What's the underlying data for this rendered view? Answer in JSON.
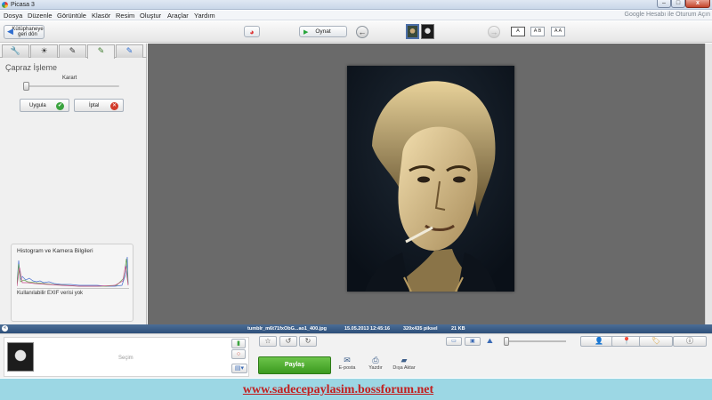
{
  "window": {
    "title": "Picasa 3",
    "controls": {
      "minimize": "–",
      "maximize": "□",
      "close": "x"
    }
  },
  "menu": {
    "items": [
      "Dosya",
      "Düzenle",
      "Görüntüle",
      "Klasör",
      "Resim",
      "Oluştur",
      "Araçlar",
      "Yardım"
    ],
    "signin": "Google Hesabı ile Oturum Açın"
  },
  "toolbar": {
    "back_to_library": "Kütüphaneye geri dön",
    "play_label": "Oynat",
    "caption_buttons": [
      "A",
      "A B",
      "A A"
    ]
  },
  "edit_panel": {
    "tabs": [
      {
        "icon": "wrench-icon",
        "glyph": "🔧"
      },
      {
        "icon": "sun-icon",
        "glyph": "☀"
      },
      {
        "icon": "brush-icon",
        "glyph": "✎"
      },
      {
        "icon": "brush-effects-icon",
        "glyph": "✎"
      },
      {
        "icon": "brush-more-icon",
        "glyph": "✎"
      }
    ],
    "active_tab": 3,
    "title": "Çapraz İşleme",
    "slider_label": "Karart",
    "slider_value": 0,
    "apply_label": "Uygula",
    "cancel_label": "İptal"
  },
  "histogram": {
    "title": "Histogram ve Kamera Bilgileri",
    "exif": "Kullanılabilir EXIF verisi yok"
  },
  "info_bar": {
    "filename": "tumblr_m6t71fxObG...ao1_400.jpg",
    "datetime": "15.05.2013 12:45:16",
    "dimensions": "320x435 piksel",
    "filesize": "21 KB"
  },
  "tray": {
    "selection_label": "Seçim",
    "share_label": "Paylaş",
    "actions": [
      "E-posta",
      "Yazdır",
      "Dışa Aktar"
    ],
    "zoom_value": 0
  },
  "banner": {
    "link_text": "www.sadecepaylasim.bossforum.net"
  },
  "colors": {
    "accent_blue": "#2d4f7a",
    "share_green": "#3b9a1f",
    "banner_bg": "#9cd7e4",
    "banner_text": "#c21f1f",
    "canvas_bg": "#6a6a6a"
  }
}
